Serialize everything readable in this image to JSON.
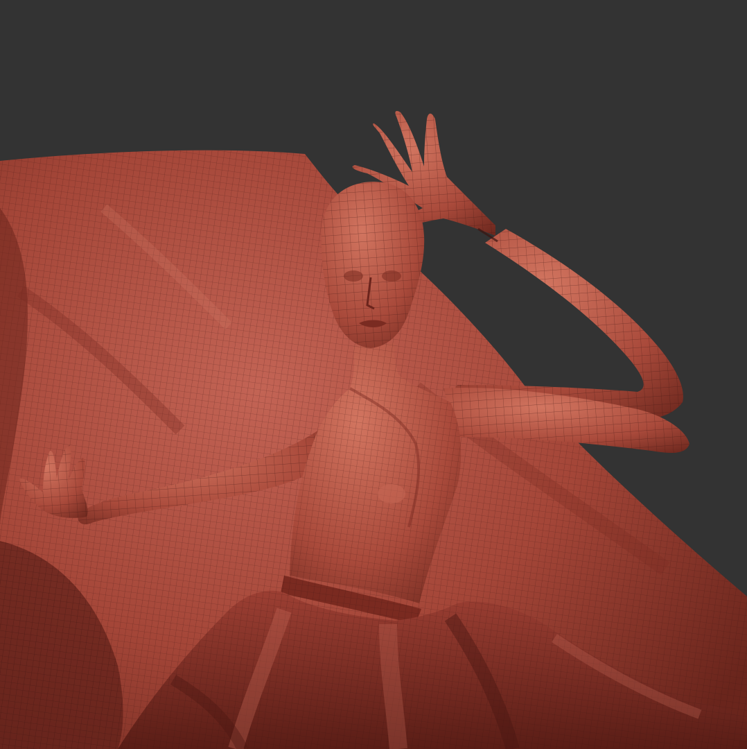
{
  "scene": {
    "colors": {
      "background": "#333333",
      "material": "#a8473a",
      "material_light": "#c86a58",
      "material_dark": "#5e1f18",
      "wire": "#3a1410"
    },
    "objects": [
      "figure",
      "cloth",
      "dress"
    ]
  }
}
